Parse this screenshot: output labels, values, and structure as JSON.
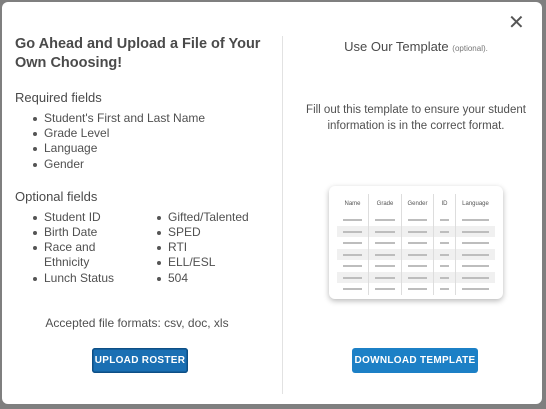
{
  "left": {
    "heading": "Go Ahead and Upload a File of Your Own Choosing!",
    "required_title": "Required fields",
    "required_items": [
      "Student's First and Last Name",
      "Grade Level",
      "Language",
      "Gender"
    ],
    "optional_title": "Optional fields",
    "optional_col1": [
      "Student ID",
      "Birth Date",
      "Race and Ethnicity",
      "Lunch Status"
    ],
    "optional_col2": [
      "Gifted/Talented",
      "SPED",
      "RTI",
      "ELL/ESL",
      "504"
    ],
    "formats": "Accepted file formats: csv, doc, xls",
    "upload_label": "UPLOAD ROSTER"
  },
  "right": {
    "title": "Use Our Template",
    "title_note": "(optional).",
    "description": "Fill out this template to ensure your student information is in the correct format.",
    "template_columns": [
      "Name",
      "Grade",
      "Gender",
      "ID",
      "Language"
    ],
    "download_label": "DOWNLOAD TEMPLATE"
  },
  "close_icon": "close-icon",
  "colors": {
    "primary": "#1c80c6",
    "primary_dark": "#1a6fb3"
  }
}
